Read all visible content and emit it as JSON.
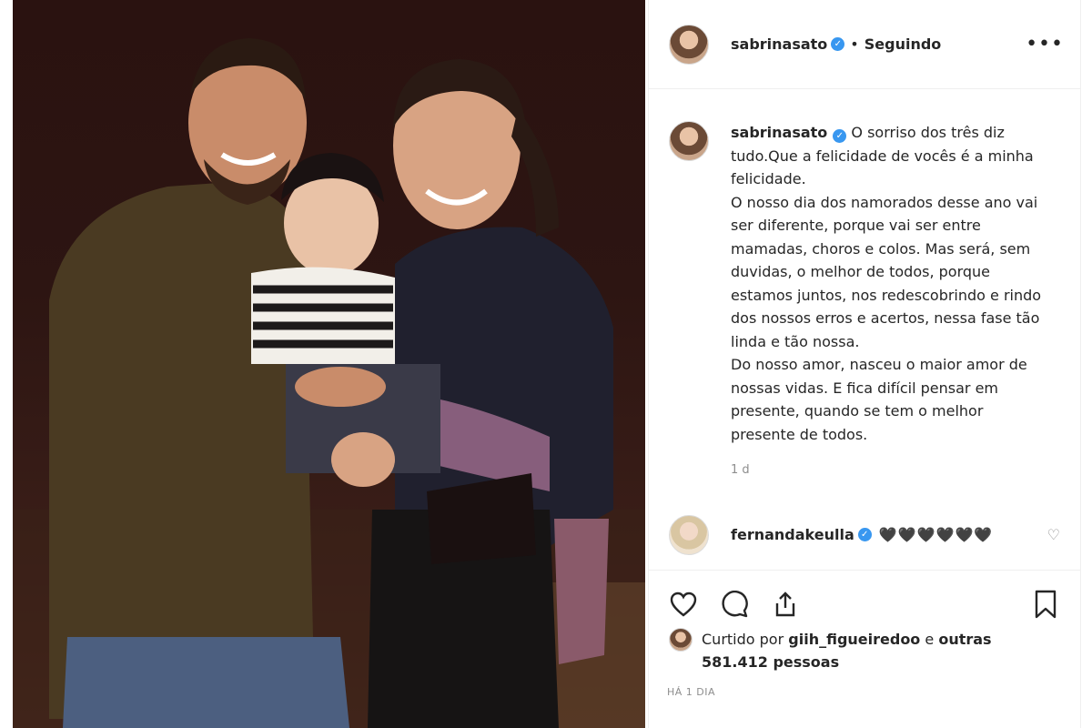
{
  "post": {
    "author": "sabrinasato",
    "follow_status": "Seguindo",
    "more_icon": "more-options-icon",
    "verified_icon": "verified-badge-icon"
  },
  "caption": {
    "author": "sabrinasato",
    "text": "O sorriso dos três diz tudo.Que a felicidade de vocês é a minha felicidade.\nO nosso dia dos namorados desse ano vai ser diferente, porque vai ser entre mamadas, choros e colos. Mas será, sem duvidas, o melhor de todos, porque estamos juntos, nos redescobrindo e rindo dos nossos erros e acertos, nessa fase tão linda e tão nossa.\nDo nosso amor, nasceu o maior amor de nossas vidas. E fica difícil pensar em presente, quando se tem o melhor presente de todos.",
    "time": "1 d"
  },
  "comments": [
    {
      "author": "fernandakeulla",
      "text": "🖤🖤🖤🖤🖤🖤"
    }
  ],
  "actions": {
    "like_icon": "heart-icon",
    "comment_icon": "comment-icon",
    "share_icon": "share-icon",
    "save_icon": "bookmark-icon"
  },
  "likes": {
    "prefix": "Curtido por",
    "first_user": "giih_figueiredoo",
    "conj": "e",
    "others": "outras 581.412 pessoas"
  },
  "posted": "HÁ 1 DIA"
}
